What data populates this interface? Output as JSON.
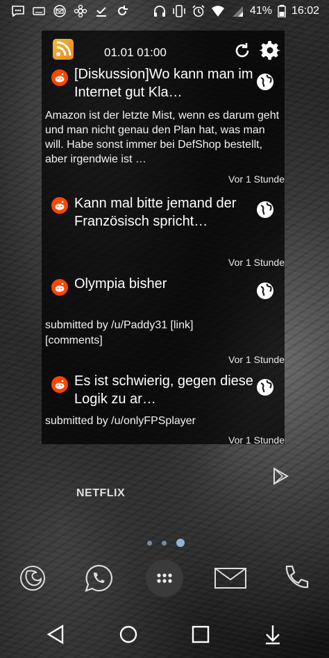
{
  "statusbar": {
    "battery_percent": "41%",
    "time": "16:02",
    "left_icons": [
      "message-icon",
      "nesk-icon",
      "mail-icon",
      "flower-icon",
      "download-check-icon",
      "sync-icon"
    ],
    "right_icons": [
      "headset-icon",
      "vibrate-icon",
      "alarm-icon",
      "wifi-icon",
      "signal-icon",
      "battery-icon"
    ]
  },
  "widget": {
    "header_time": "01.01 01:00",
    "items": [
      {
        "title": "[Diskussion]Wo kann man im Internet gut Kla…",
        "body": "Amazon ist der letzte Mist, wenn es darum geht und man nicht genau den Plan hat, was man will. Habe sonst immer bei DefShop bestellt, aber irgendwie ist …",
        "time": "Vor 1 Stunde"
      },
      {
        "title": "Kann mal bitte jemand der Französisch spricht…",
        "time": "Vor 1 Stunde"
      },
      {
        "title": "Olympia bisher",
        "meta_line1": "submitted by    /u/Paddy31   [link]",
        "meta_line2": "[comments]",
        "time": "Vor 1 Stunde"
      },
      {
        "title": "Es ist schwierig, gegen diese Logik zu ar…",
        "meta_line1": "submitted by    /u/onlyFPSplayer",
        "time": "Vor 1 Stunde"
      }
    ]
  },
  "home": {
    "netflix_label": "NETFLIX",
    "page_count": 3,
    "active_page": 3
  },
  "dock": {
    "apps": [
      "firefox-icon",
      "whatsapp-icon",
      "apps-drawer-icon",
      "email-icon",
      "phone-icon"
    ]
  },
  "navbar": {
    "buttons": [
      "back-button",
      "home-button",
      "recents-button",
      "notifications-pull-button"
    ]
  }
}
